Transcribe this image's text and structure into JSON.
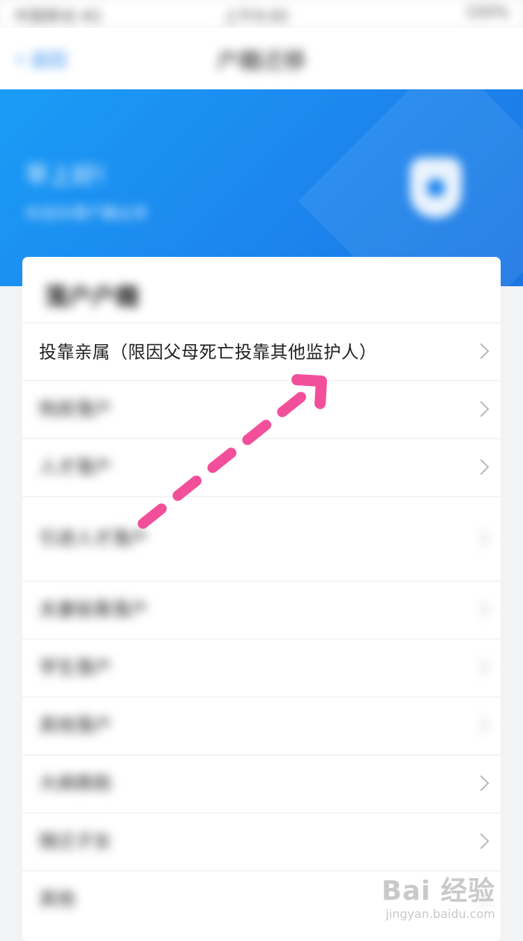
{
  "statusbar": {
    "carrier": "中国移动 4G",
    "time": "上午9:00",
    "battery": "100%"
  },
  "nav": {
    "back_label": "返回",
    "title": "户籍迁移"
  },
  "banner": {
    "greeting": "早上好!",
    "subtitle": "欢迎办理户籍业务"
  },
  "card": {
    "title": "落户户籍",
    "items": [
      {
        "label": "投靠亲属（限因父母死亡投靠其他监护人）"
      },
      {
        "label": "购房落户"
      },
      {
        "label": "人才落户"
      },
      {
        "label": "引进人才落户"
      },
      {
        "label": "夫妻投靠落户"
      },
      {
        "label": "学生落户"
      },
      {
        "label": "其他落户"
      },
      {
        "label": "大病救助"
      },
      {
        "label": "随迁子女"
      },
      {
        "label": "其他"
      }
    ]
  },
  "watermark": {
    "logo": "Bai 经验",
    "url": "jingyan.baidu.com"
  },
  "colors": {
    "primary": "#1c86ee",
    "arrow": "#f24f9b"
  }
}
